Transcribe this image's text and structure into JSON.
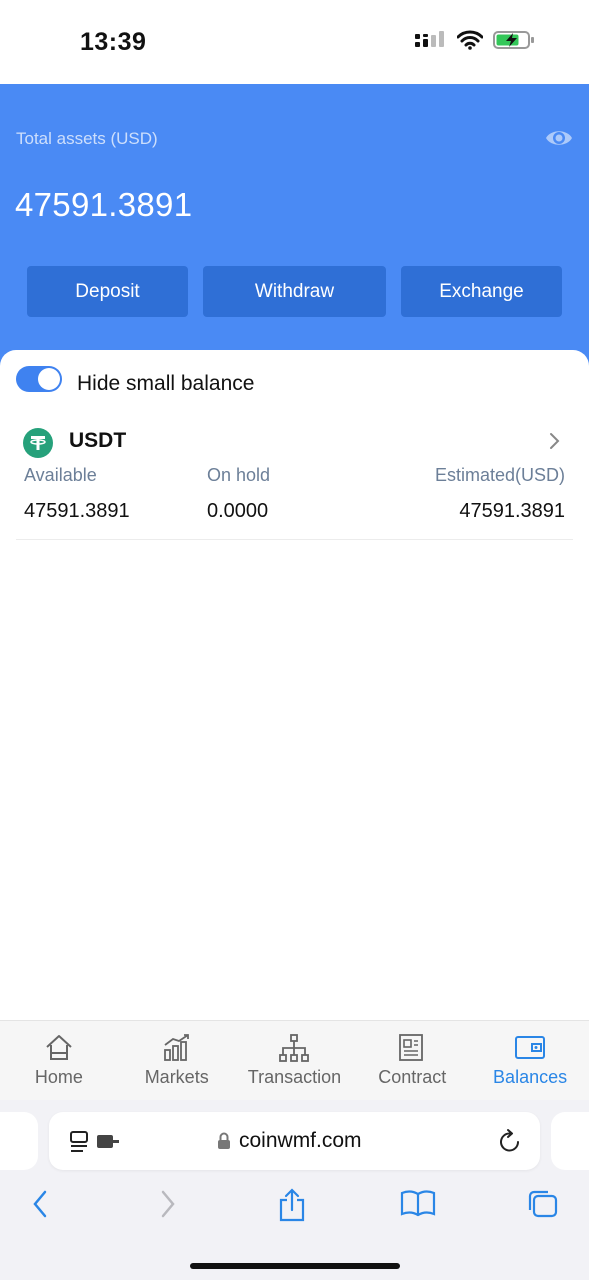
{
  "status_bar": {
    "time": "13:39"
  },
  "assets": {
    "label": "Total assets (USD)",
    "total": "47591.3891",
    "actions": {
      "deposit": "Deposit",
      "withdraw": "Withdraw",
      "exchange": "Exchange"
    }
  },
  "balances": {
    "hide_small_label": "Hide small balance",
    "hide_small_enabled": true,
    "columns": {
      "available": "Available",
      "on_hold": "On hold",
      "estimated": "Estimated(USD)"
    },
    "items": [
      {
        "symbol": "USDT",
        "icon": "tether-icon",
        "available": "47591.3891",
        "on_hold": "0.0000",
        "estimated": "47591.3891"
      }
    ]
  },
  "tab_bar": {
    "items": [
      {
        "label": "Home",
        "icon": "home-icon",
        "active": false
      },
      {
        "label": "Markets",
        "icon": "markets-icon",
        "active": false
      },
      {
        "label": "Transaction",
        "icon": "transaction-icon",
        "active": false
      },
      {
        "label": "Contract",
        "icon": "contract-icon",
        "active": false
      },
      {
        "label": "Balances",
        "icon": "wallet-icon",
        "active": true
      }
    ]
  },
  "browser": {
    "url": "coinwmf.com"
  },
  "colors": {
    "header_blue": "#4a8af4",
    "button_blue": "#2f6fd6",
    "active_tab": "#2a86e6",
    "tether_green": "#26a17b"
  }
}
